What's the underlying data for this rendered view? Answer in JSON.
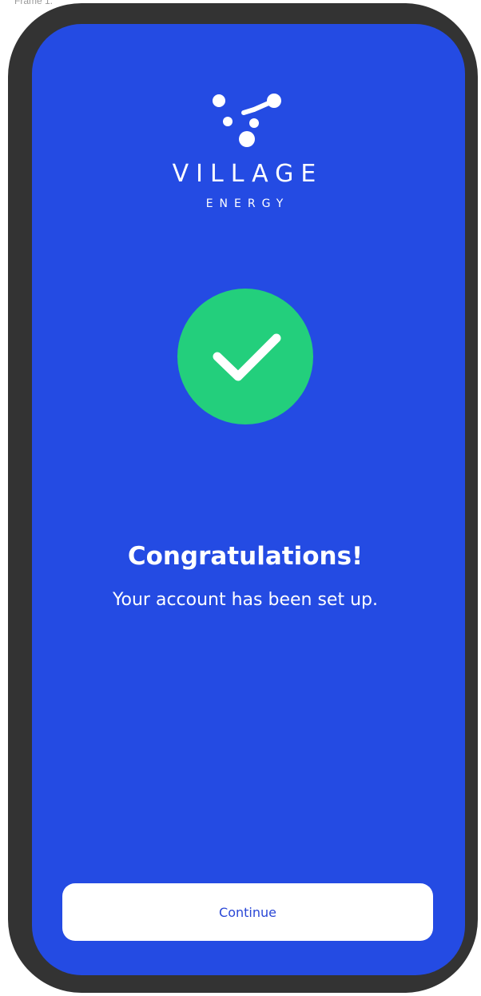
{
  "frame": {
    "label": "Frame 1."
  },
  "brand": {
    "name": "VILLAGE",
    "sub": "ENERGY",
    "logo_icon": "molecule-dots-icon"
  },
  "status": {
    "icon": "check-icon",
    "headline": "Congratulations!",
    "message": "Your account has been set up."
  },
  "actions": {
    "continue_label": "Continue"
  },
  "colors": {
    "screen_background": "#244be3",
    "device_frame": "#333333",
    "success_circle": "#23cf7c",
    "button_background": "#ffffff",
    "button_text": "#2a47d6"
  }
}
